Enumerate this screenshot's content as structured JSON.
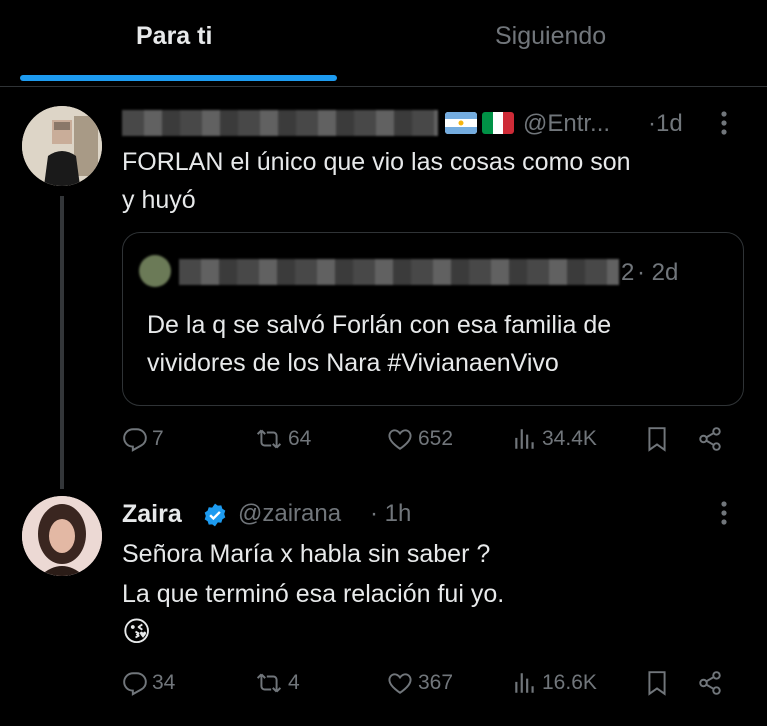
{
  "tabs": {
    "for_you": "Para ti",
    "following": "Siguiendo"
  },
  "post1": {
    "handle": "@Entr...",
    "time": "·1d",
    "text_line1": "FORLAN el único que vio las cosas como son",
    "text_line2": "y huyó",
    "quote": {
      "handle_end": "2",
      "time": "· 2d",
      "text_line1": "De la q se salvó Forlán con esa familia de",
      "text_line2": "vividores de los Nara #VivianaenVivo"
    },
    "stats": {
      "replies": "7",
      "reposts": "64",
      "likes": "652",
      "views": "34.4K"
    }
  },
  "post2": {
    "name": "Zaira",
    "handle": "@zairana",
    "time": "· 1h",
    "text_line1": "Señora María x habla sin saber ?",
    "text_line2": "La que terminó esa relación fui yo.",
    "emoji": "😘",
    "stats": {
      "replies": "34",
      "reposts": "4",
      "likes": "367",
      "views": "16.6K"
    }
  },
  "colors": {
    "accent": "#1d9bf0",
    "muted": "#71767b",
    "text": "#e7e9ea",
    "border": "#2f3336"
  },
  "icons": [
    "reply-icon",
    "repost-icon",
    "like-icon",
    "views-icon",
    "bookmark-icon",
    "share-icon",
    "more-icon",
    "verified-icon",
    "flag-argentina-icon",
    "flag-italy-icon"
  ]
}
